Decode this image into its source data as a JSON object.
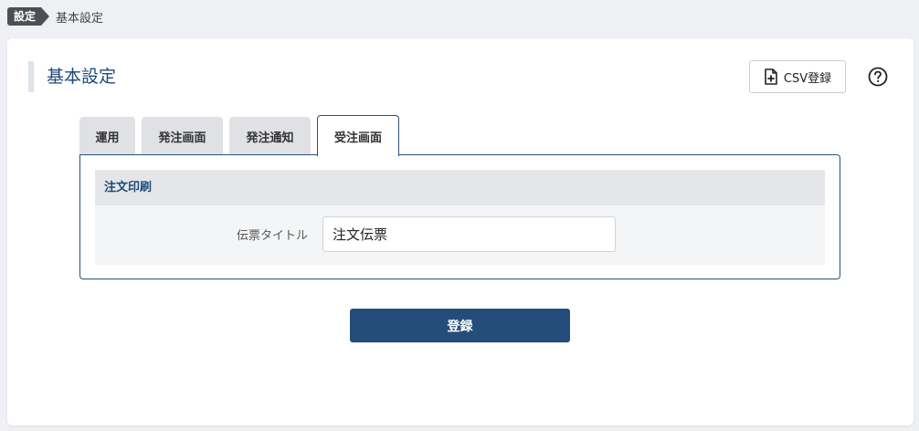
{
  "breadcrumb": {
    "root": "設定",
    "current": "基本設定"
  },
  "header": {
    "title": "基本設定",
    "csv_button_label": "CSV登録",
    "csv_icon": "file-plus-icon",
    "help_icon": "question-circle-icon"
  },
  "tabs": [
    {
      "label": "運用",
      "active": false
    },
    {
      "label": "発注画面",
      "active": false
    },
    {
      "label": "発注通知",
      "active": false
    },
    {
      "label": "受注画面",
      "active": true
    }
  ],
  "section": {
    "title": "注文印刷",
    "fields": [
      {
        "label": "伝票タイトル",
        "value": "注文伝票"
      }
    ]
  },
  "footer": {
    "submit_label": "登録"
  },
  "colors": {
    "accent": "#254d7b",
    "title": "#1f4a78",
    "breadcrumb_bg": "#4b4f56",
    "tab_inactive": "#dfe1e5"
  }
}
